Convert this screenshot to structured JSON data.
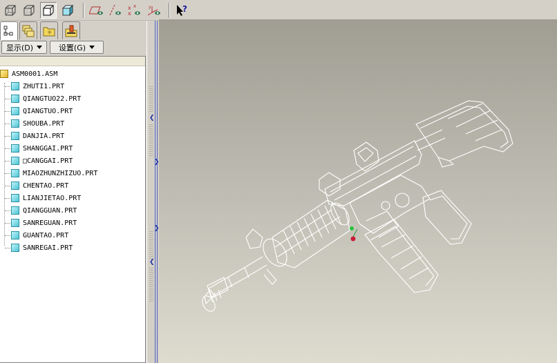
{
  "toolbar": {
    "view_buttons": [
      {
        "icon": "wireframe-cube-icon"
      },
      {
        "icon": "hidden-line-cube-icon"
      },
      {
        "icon": "no-hidden-cube-icon",
        "pressed": true
      },
      {
        "icon": "shaded-cube-icon"
      }
    ],
    "datum_buttons": [
      {
        "icon": "datum-plane-display-icon"
      },
      {
        "icon": "datum-axis-display-icon"
      },
      {
        "icon": "datum-point-display-icon"
      },
      {
        "icon": "coordinate-system-display-icon"
      }
    ],
    "help_button": {
      "icon": "context-help-icon"
    }
  },
  "navigator": {
    "tabs": [
      {
        "icon": "model-tree-tab-icon",
        "active": true
      },
      {
        "icon": "layers-tab-icon"
      },
      {
        "icon": "folder-browser-tab-icon"
      },
      {
        "icon": "favorites-tab-icon"
      }
    ],
    "display_menu_label": "显示(D)",
    "settings_menu_label": "设置(G)"
  },
  "model_tree": {
    "root": "ASM0001.ASM",
    "parts": [
      "ZHUTI1.PRT",
      "QIANGTUO22.PRT",
      "QIANGTUO.PRT",
      "SHOUBA.PRT",
      "DANJIA.PRT",
      "SHANGGAI.PRT",
      "□CANGGAI.PRT",
      "MIAOZHUNZHIZUO.PRT",
      "CHENTAO.PRT",
      "LIANJIETAO.PRT",
      "QIANGGUAN.PRT",
      "SANREGUAN.PRT",
      "GUANTAO.PRT",
      "SANREGAI.PRT"
    ]
  },
  "colors": {
    "panel_bg": "#d4d0c8",
    "viewport_top": "#a09e93",
    "viewport_bottom": "#dedccf",
    "wireframe": "#ffffff",
    "splitter_accent": "#4a5fc8"
  }
}
